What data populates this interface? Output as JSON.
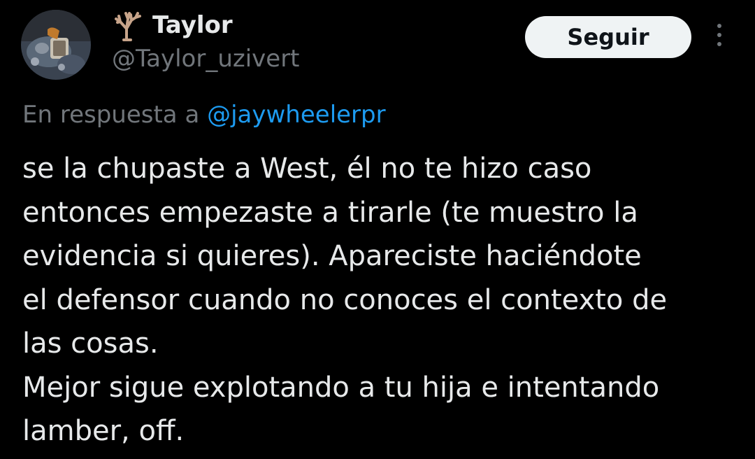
{
  "author": {
    "display_name": "Taylor",
    "handle": "@Taylor_uzivert",
    "name_icon": "bare-tree-emoji-icon",
    "avatar_icon": "avatar-photo"
  },
  "actions": {
    "follow_label": "Seguir",
    "more_icon": "more-options-icon"
  },
  "reply": {
    "prefix": "En respuesta a",
    "mention": "@jaywheelerpr"
  },
  "tweet": {
    "lines": [
      "se la chupaste a West, él no te hizo caso",
      "entonces empezaste a tirarle (te muestro la",
      "evidencia si quieres). Apareciste haciéndote",
      "el defensor cuando no conoces el contexto de",
      "las cosas.",
      "Mejor sigue explotando a tu hija e intentando",
      "lamber, off."
    ]
  },
  "colors": {
    "background": "#000000",
    "text_primary": "#e7e9ea",
    "text_secondary": "#71767b",
    "link": "#1d9bf0",
    "button_bg": "#eff3f4",
    "button_text": "#0f1419"
  }
}
